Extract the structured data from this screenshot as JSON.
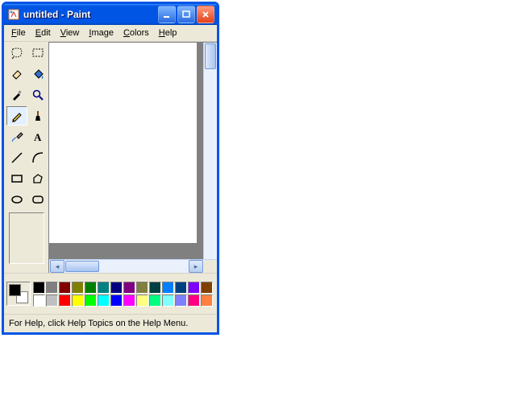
{
  "title": "untitled - Paint",
  "menus": {
    "file": "File",
    "edit": "Edit",
    "view": "View",
    "image": "Image",
    "colors": "Colors",
    "help": "Help"
  },
  "tools": {
    "freeform_select": "free-form-select",
    "rect_select": "rectangle-select",
    "eraser": "eraser",
    "fill": "fill-bucket",
    "picker": "color-picker",
    "magnifier": "magnifier",
    "pencil": "pencil",
    "brush": "brush",
    "airbrush": "airbrush",
    "text": "text",
    "line": "line",
    "curve": "curve",
    "rect": "rectangle",
    "polygon": "polygon",
    "ellipse": "ellipse",
    "rounded_rect": "rounded-rectangle"
  },
  "selected_tool": "pencil",
  "colors": {
    "fg": "#000000",
    "bg": "#ffffff",
    "row1": [
      "#000000",
      "#808080",
      "#800000",
      "#808000",
      "#008000",
      "#008080",
      "#000080",
      "#800080",
      "#808040",
      "#004040",
      "#0080ff",
      "#004080",
      "#8000ff",
      "#804000"
    ],
    "row2": [
      "#ffffff",
      "#c0c0c0",
      "#ff0000",
      "#ffff00",
      "#00ff00",
      "#00ffff",
      "#0000ff",
      "#ff00ff",
      "#ffff80",
      "#00ff80",
      "#80ffff",
      "#8080ff",
      "#ff0080",
      "#ff8040"
    ]
  },
  "status": "For Help, click Help Topics on the Help Menu."
}
